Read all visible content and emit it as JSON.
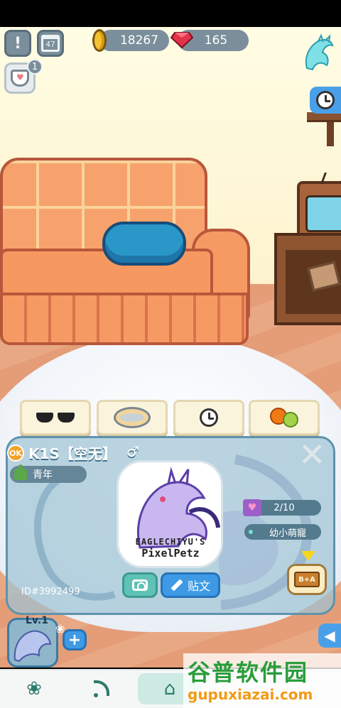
{
  "hud": {
    "alert_label": "!",
    "calendar_day": "47",
    "coins": "18267",
    "gems": "165",
    "bag_badge": "1"
  },
  "actions": [
    {
      "icon": "sunglasses-icon"
    },
    {
      "icon": "food-bowl-icon"
    },
    {
      "icon": "clock-icon"
    },
    {
      "icon": "fruit-icon"
    }
  ],
  "pet": {
    "name": "K1S【空无】",
    "gender": "♂",
    "badge": "OK",
    "stage": "青年",
    "id": "ID#3992499",
    "affection": "2/10",
    "title": "幼小萌寵",
    "brand_top": "EAGLECHIYU'S",
    "brand_bottom": "PixelPetz",
    "post_label": "贴文",
    "tag_label": "B+A",
    "level": "Lv.1"
  },
  "watermark": {
    "name": "谷普软件园",
    "url": "gupuxiazai.com"
  },
  "colors": {
    "accent_blue": "#3e9ae4",
    "teal": "#5ec2b6",
    "hud_gray": "#7b8e9b",
    "nav_green": "#2c7a6a"
  }
}
